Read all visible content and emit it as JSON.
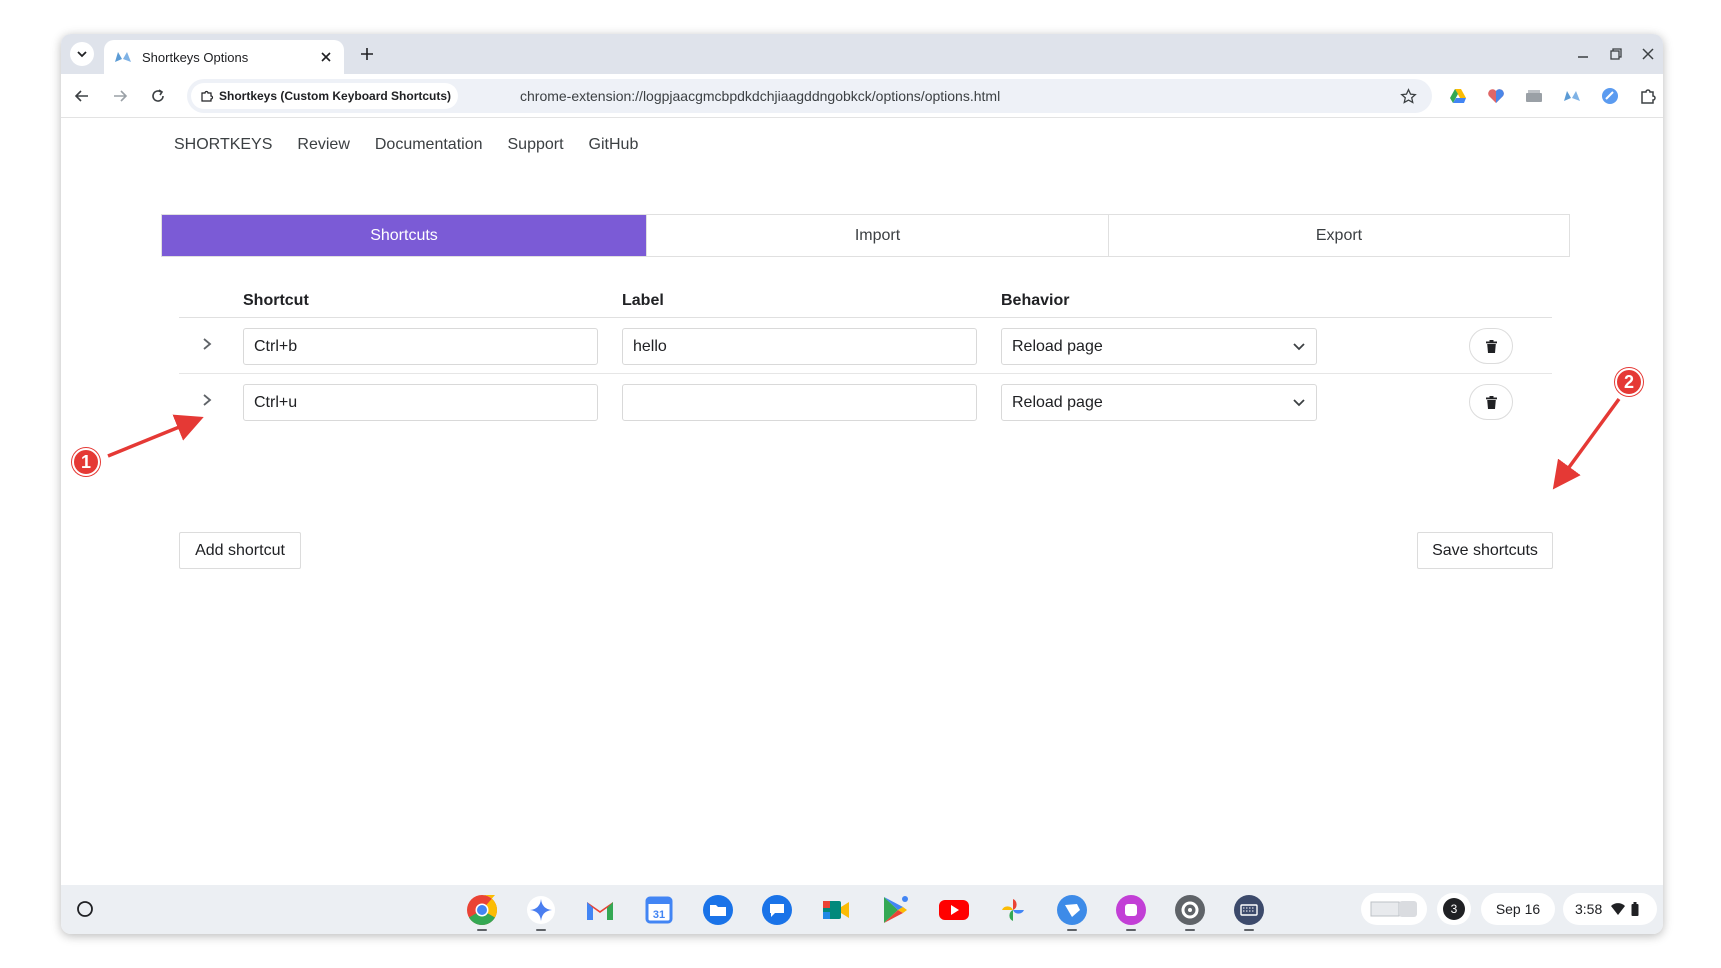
{
  "browser": {
    "tab_title": "Shortkeys Options",
    "site_chip": "Shortkeys (Custom Keyboard Shortcuts)",
    "url": "chrome-extension://logpjaacgmcbpdkdchjiaagddngobkck/options/options.html"
  },
  "nav": {
    "items": [
      "SHORTKEYS",
      "Review",
      "Documentation",
      "Support",
      "GitHub"
    ]
  },
  "tabs": [
    "Shortcuts",
    "Import",
    "Export"
  ],
  "table": {
    "headers": {
      "shortcut": "Shortcut",
      "label": "Label",
      "behavior": "Behavior"
    },
    "rows": [
      {
        "shortcut": "Ctrl+b",
        "label": "hello",
        "behavior": "Reload page"
      },
      {
        "shortcut": "Ctrl+u",
        "label": "",
        "behavior": "Reload page"
      }
    ]
  },
  "buttons": {
    "add": "Add shortcut",
    "save": "Save shortcuts"
  },
  "shelf": {
    "notification_count": "3",
    "date": "Sep 16",
    "time": "3:58"
  },
  "annotations": [
    "1",
    "2"
  ],
  "colors": {
    "accent": "#7b5bd6",
    "annotation": "#e53935"
  }
}
